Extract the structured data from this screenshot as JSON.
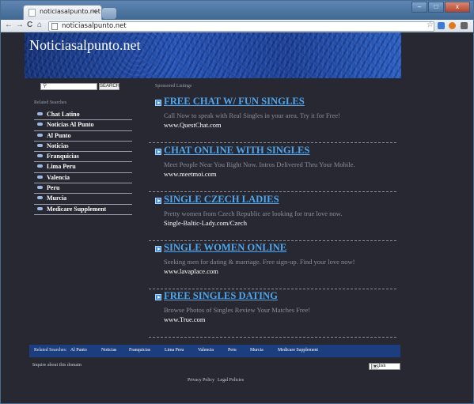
{
  "browser": {
    "tab_title": "noticiasalpunto.net",
    "tab_close": "×",
    "url": "noticiasalpunto.net",
    "nav_back": "←",
    "nav_forward": "→",
    "nav_reload": "C",
    "nav_home": "⌂",
    "star": "☆",
    "window_min": "–",
    "window_max": "□",
    "window_close": "x"
  },
  "site": {
    "title": "Noticiasalpunto.net"
  },
  "search": {
    "placeholder": "",
    "button_label": "SEARCH"
  },
  "sidebar": {
    "heading": "Related Searches",
    "items": [
      {
        "label": "Chat Latino"
      },
      {
        "label": "Noticias Al Punto"
      },
      {
        "label": "Al Punto"
      },
      {
        "label": "Noticias"
      },
      {
        "label": "Franquicias"
      },
      {
        "label": "Lima Peru"
      },
      {
        "label": "Valencia"
      },
      {
        "label": "Peru"
      },
      {
        "label": "Murcia"
      },
      {
        "label": "Medicare Supplement"
      }
    ]
  },
  "main": {
    "sponsored_label": "Sponsored Listings",
    "listings": [
      {
        "title": "FREE CHAT W/ FUN SINGLES",
        "desc": "Call Now to speak with Real Singles in your area. Try it for Free!",
        "url": "www.QuestChat.com"
      },
      {
        "title": "CHAT ONLINE WITH SINGLES",
        "desc": "Meet People Near You Right Now. Intros Delivered Thru Your Mobile.",
        "url": "www.meetmoi.com"
      },
      {
        "title": "SINGLE CZECH LADIES",
        "desc": "Pretty women from Czech Republic are looking for true love now.",
        "url": "Single-Baltic-Lady.com/Czech"
      },
      {
        "title": "SINGLE WOMEN ONLINE",
        "desc": "Seeking men for dating & marriage. Free sign-up. Find your love now!",
        "url": "www.lavaplace.com"
      },
      {
        "title": "FREE SINGLES DATING",
        "desc": "Browse Photos of Singles Review Your Matches Free!",
        "url": "www.True.com"
      }
    ]
  },
  "bottom_bar": {
    "label": "Related Searches:",
    "links": [
      "Al Punto",
      "Noticias",
      "Franquicias",
      "Lima Peru",
      "Valencia",
      "Peru",
      "Murcia",
      "Medicare Supplement"
    ]
  },
  "inquire_text": "Inquire about this domain",
  "language": {
    "selected": "English"
  },
  "footer": {
    "privacy": "Privacy Policy",
    "legal": "Legal Policies"
  }
}
